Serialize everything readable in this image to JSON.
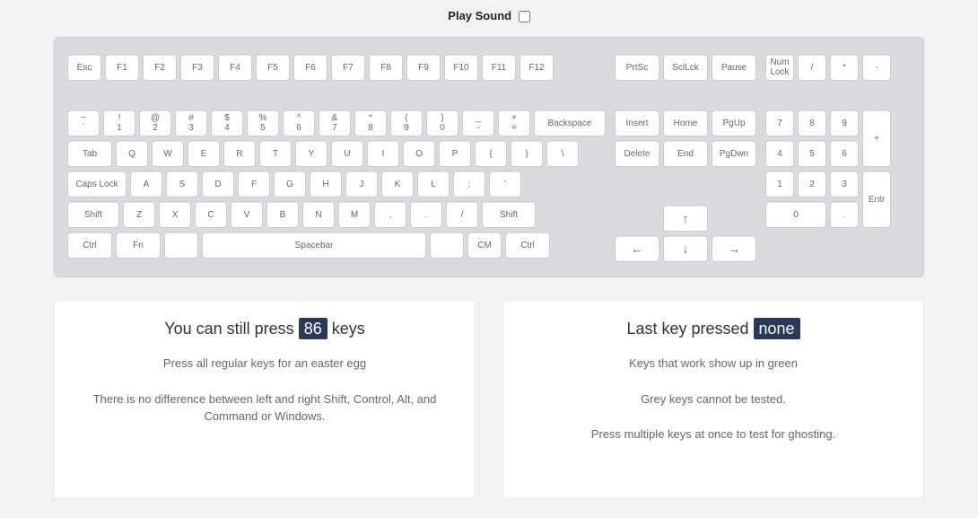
{
  "sound_label": "Play Sound",
  "main": {
    "r1": [
      "Esc",
      "F1",
      "F2",
      "F3",
      "F4",
      "F5",
      "F6",
      "F7",
      "F8",
      "F9",
      "F10",
      "F11",
      "F12"
    ],
    "r2": {
      "pairs": [
        [
          "`",
          "~"
        ],
        [
          "1",
          "!"
        ],
        [
          "2",
          "@"
        ],
        [
          "3",
          "#"
        ],
        [
          "4",
          "$"
        ],
        [
          "5",
          "%"
        ],
        [
          "6",
          "^"
        ],
        [
          "7",
          "&"
        ],
        [
          "8",
          "*"
        ],
        [
          "9",
          "("
        ],
        [
          "0",
          ")"
        ],
        [
          "-",
          "_"
        ],
        [
          "=",
          "+"
        ]
      ],
      "backspace": "Backspace"
    },
    "r3": {
      "tab": "Tab",
      "letters": [
        "Q",
        "W",
        "E",
        "R",
        "T",
        "Y",
        "U",
        "I",
        "O",
        "P",
        "{",
        "}",
        "\\"
      ]
    },
    "r4": {
      "caps": "Caps Lock",
      "letters": [
        "A",
        "S",
        "D",
        "F",
        "G",
        "H",
        "J",
        "K",
        "L",
        ";",
        "'"
      ]
    },
    "r5": {
      "shiftL": "Shift",
      "letters": [
        "Z",
        "X",
        "C",
        "V",
        "B",
        "N",
        "M",
        ",",
        ".",
        "/"
      ],
      "shiftR": "Shift"
    },
    "r6": {
      "ctrlL": "Ctrl",
      "fn": "Fn",
      "alt": "",
      "space": "Spacebar",
      "altR": "",
      "cm": "CM",
      "ctrlR": "Ctrl"
    }
  },
  "nav": {
    "top": [
      "PrtSc",
      "SclLck",
      "Pause"
    ],
    "mid1": [
      "Insert",
      "Home",
      "PgUp"
    ],
    "mid2": [
      "Delete",
      "End",
      "PgDwn"
    ],
    "arrows": {
      "up": "↑",
      "left": "←",
      "down": "↓",
      "right": "→"
    }
  },
  "numpad": {
    "r1": [
      "Num Lock",
      "/",
      "*",
      "-"
    ],
    "r2": [
      "7",
      "8",
      "9"
    ],
    "r3": [
      "4",
      "5",
      "6"
    ],
    "plus": "+",
    "r4": [
      "1",
      "2",
      "3"
    ],
    "r5_zero": "0",
    "r5_dot": ".",
    "enter": "Entr"
  },
  "card_left": {
    "title_pre": "You can still press ",
    "count": "86",
    "title_post": " keys",
    "p1": "Press all regular keys for an easter egg",
    "p2": "There is no difference between left and right Shift, Control, Alt, and Command or Windows."
  },
  "card_right": {
    "title_pre": "Last key pressed ",
    "value": "none",
    "p1": "Keys that work show up in green",
    "p2": "Grey keys cannot be tested.",
    "p3": "Press multiple keys at once to test for ghosting."
  }
}
